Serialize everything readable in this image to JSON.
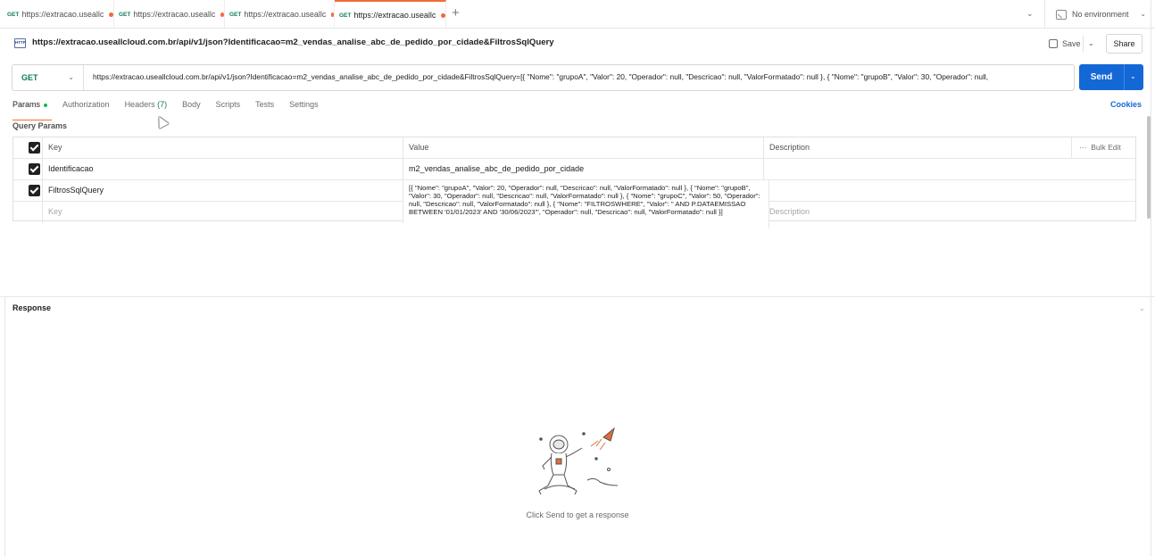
{
  "tabs": [
    {
      "method": "GET",
      "title": "https://extracao.useallc"
    },
    {
      "method": "GET",
      "title": "https://extracao.useallc"
    },
    {
      "method": "GET",
      "title": "https://extracao.useallc"
    },
    {
      "method": "GET",
      "title": "https://extracao.useallc"
    }
  ],
  "new_tab": "+",
  "environment": "No environment",
  "request": {
    "title": "https://extracao.useallcloud.com.br/api/v1/json?Identificacao=m2_vendas_analise_abc_de_pedido_por_cidade&FiltrosSqlQuery",
    "method": "GET",
    "url": "https://extracao.useallcloud.com.br/api/v1/json?Identificacao=m2_vendas_analise_abc_de_pedido_por_cidade&FiltrosSqlQuery=[{ \"Nome\": \"grupoA\", \"Valor\": 20, \"Operador\": null, \"Descricao\": null, \"ValorFormatado\": null }, { \"Nome\": \"grupoB\", \"Valor\": 30, \"Operador\": null,"
  },
  "actions": {
    "save": "Save",
    "share": "Share",
    "send": "Send"
  },
  "subtabs": {
    "params": "Params",
    "authorization": "Authorization",
    "headers": "Headers",
    "headers_count": "(7)",
    "body": "Body",
    "scripts": "Scripts",
    "tests": "Tests",
    "settings": "Settings",
    "cookies": "Cookies"
  },
  "query_params": {
    "label": "Query Params",
    "headers": {
      "key": "Key",
      "value": "Value",
      "description": "Description",
      "bulk_edit": "Bulk Edit"
    },
    "rows": [
      {
        "key": "Identificacao",
        "value": "m2_vendas_analise_abc_de_pedido_por_cidade"
      },
      {
        "key": "FiltrosSqlQuery",
        "value": "[{ \"Nome\": \"grupoA\", \"Valor\": 20, \"Operador\": null, \"Descricao\": null, \"ValorFormatado\": null }, { \"Nome\": \"grupoB\", \"Valor\": 30, \"Operador\": null, \"Descricao\": null, \"ValorFormatado\": null }, { \"Nome\": \"grupoC\", \"Valor\": 50, \"Operador\": null, \"Descricao\": null, \"ValorFormatado\": null }, { \"Nome\": \"FILTROSWHERE\", \"Valor\": \" AND P.DATAEMISSAO BETWEEN '01/01/2023' AND '30/06/2023'\", \"Operador\": null, \"Descricao\": null, \"ValorFormatado\": null }]"
      }
    ],
    "placeholder_key": "Key",
    "placeholder_description": "Description"
  },
  "response": {
    "label": "Response",
    "empty_message": "Click Send to get a response"
  },
  "colors": {
    "accent": "#f26b3a",
    "send": "#1468d6",
    "get": "#0d7d57"
  }
}
